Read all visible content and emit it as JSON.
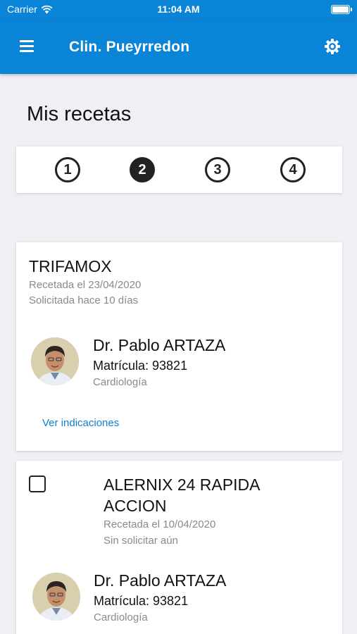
{
  "status_bar": {
    "carrier": "Carrier",
    "time": "11:04 AM"
  },
  "app_bar": {
    "title": "Clin. Pueyrredon"
  },
  "page": {
    "title": "Mis recetas"
  },
  "steps": [
    "1",
    "2",
    "3",
    "4"
  ],
  "active_step": 2,
  "prescriptions": [
    {
      "drug": "TRIFAMOX",
      "prescribed": "Recetada el 23/04/2020",
      "status": "Solicitada hace 10 días",
      "doctor": {
        "name": "Dr. Pablo ARTAZA",
        "license": "Matrícula: 93821",
        "specialty": "Cardiología"
      },
      "link": "Ver indicaciones"
    },
    {
      "drug_line1": "ALERNIX 24 RAPIDA",
      "drug_line2": "ACCION",
      "prescribed": "Recetada el 10/04/2020",
      "status": "Sin solicitar aún",
      "doctor": {
        "name": "Dr. Pablo ARTAZA",
        "license": "Matrícula: 93821",
        "specialty": "Cardiología"
      }
    }
  ],
  "colors": {
    "primary": "#0a84d6",
    "link": "#0a7fd4",
    "background": "#efeff4"
  }
}
